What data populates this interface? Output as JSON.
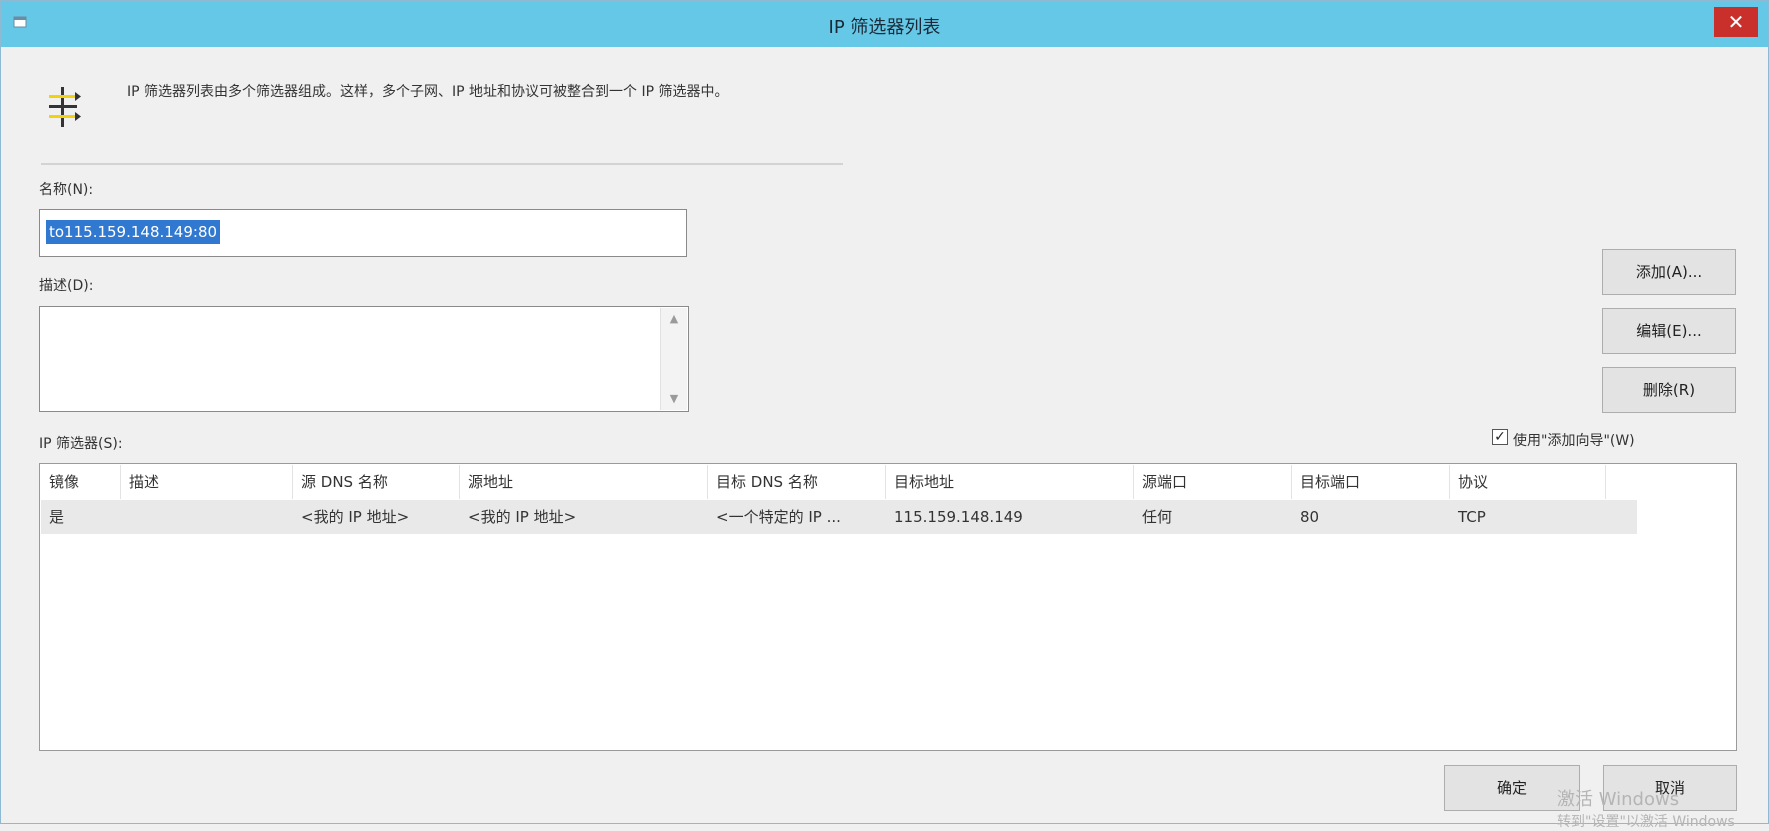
{
  "window": {
    "title": "IP 筛选器列表",
    "close_glyph": "✕",
    "icon": "filter-list-icon"
  },
  "intro": {
    "text": "IP 筛选器列表由多个筛选器组成。这样，多个子网、IP 地址和协议可被整合到一个 IP 筛选器中。"
  },
  "name_field": {
    "label": "名称(N):",
    "value": "to115.159.148.149:80"
  },
  "description_field": {
    "label": "描述(D):",
    "value": ""
  },
  "buttons": {
    "add": "添加(A)...",
    "edit": "编辑(E)...",
    "remove": "删除(R)",
    "ok": "确定",
    "cancel": "取消"
  },
  "wizard_checkbox": {
    "label": "使用\"添加向导\"(W)",
    "checked": true
  },
  "filters": {
    "label": "IP 筛选器(S):",
    "columns": [
      "镜像",
      "描述",
      "源 DNS 名称",
      "源地址",
      "目标 DNS 名称",
      "目标地址",
      "源端口",
      "目标端口",
      "协议"
    ],
    "rows": [
      [
        "是",
        "",
        "<我的 IP 地址>",
        "<我的 IP 地址>",
        "<一个特定的 IP ...",
        "115.159.148.149",
        "任何",
        "80",
        "TCP"
      ]
    ]
  },
  "watermark": {
    "line1": "激活 Windows",
    "line2": "转到\"设置\"以激活 Windows"
  },
  "colors": {
    "titlebar": "#66c8e7",
    "close": "#c9302c",
    "selection": "#3078d0"
  }
}
